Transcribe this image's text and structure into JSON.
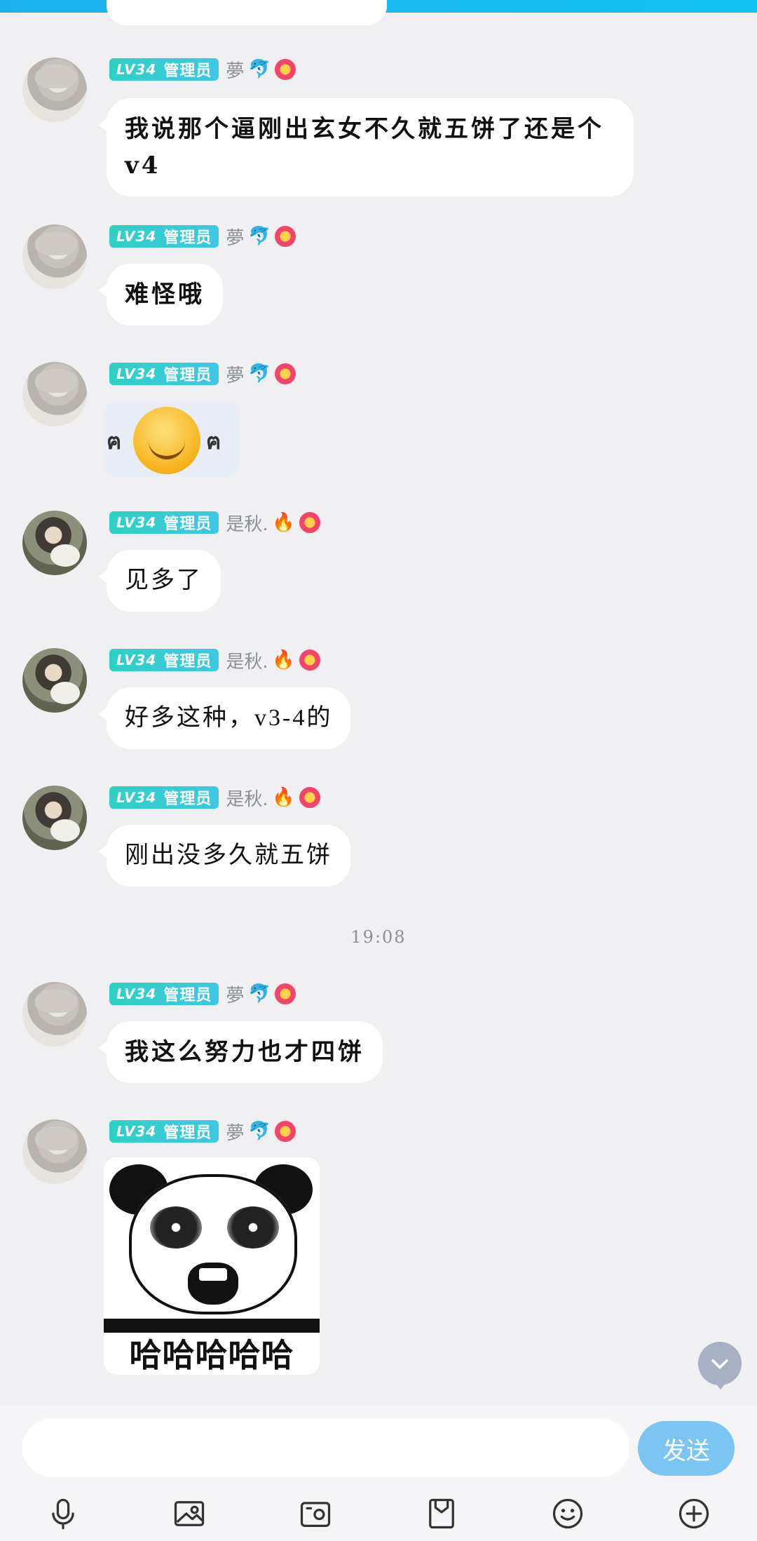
{
  "colors": {
    "accent": "#12c2f0",
    "send_bg": "#7cc5f3",
    "level_badge": "#2fd0c2",
    "bubble": "#ffffff",
    "background": "#f0f0f2"
  },
  "messages": [
    {
      "user": "夢",
      "level": "LV34",
      "role": "管理员",
      "text": "我说那个逼刚出玄女不久就五饼了还是个v4"
    },
    {
      "user": "夢",
      "level": "LV34",
      "role": "管理员",
      "text": "难怪哦"
    },
    {
      "user": "夢",
      "level": "LV34",
      "role": "管理员",
      "sticker": "smiling-face-sticker"
    },
    {
      "user": "是秋.",
      "level": "LV34",
      "role": "管理员",
      "text": "见多了"
    },
    {
      "user": "是秋.",
      "level": "LV34",
      "role": "管理员",
      "text": "好多这种，v3-4的"
    },
    {
      "user": "是秋.",
      "level": "LV34",
      "role": "管理员",
      "text": "刚出没多久就五饼"
    },
    {
      "user": "夢",
      "level": "LV34",
      "role": "管理员",
      "text": "我这么努力也才四饼"
    },
    {
      "user": "夢",
      "level": "LV34",
      "role": "管理员",
      "sticker": "panda-laugh-sticker",
      "sticker_text": "哈哈哈哈哈"
    }
  ],
  "timestamp": "19:08",
  "composer": {
    "input_value": "",
    "placeholder": "",
    "send_label": "发送"
  },
  "toolbar": [
    "microphone-icon",
    "image-icon",
    "camera-icon",
    "file-icon",
    "emoji-icon",
    "plus-icon"
  ]
}
